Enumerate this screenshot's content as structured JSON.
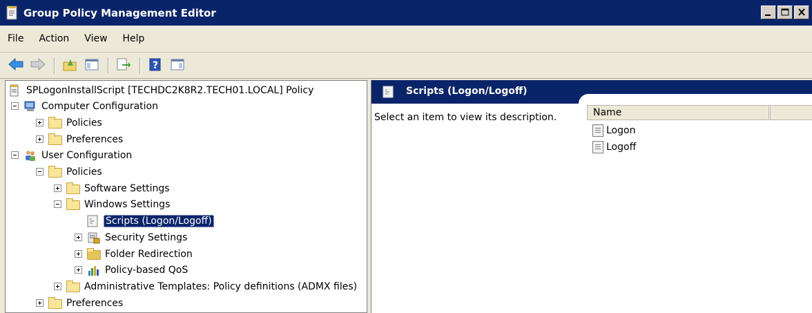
{
  "window": {
    "title": "Group Policy Management Editor",
    "title_bar_color": "#0a246a"
  },
  "menu": [
    "File",
    "Action",
    "View",
    "Help"
  ],
  "toolbar": {
    "buttons": [
      "back-arrow-icon",
      "forward-arrow-icon",
      "up-folder-icon",
      "show-hide-tree-icon",
      "export-list-icon",
      "help-icon",
      "properties-pane-icon"
    ]
  },
  "tree": {
    "root": "SPLogonInstallScript [TECHDC2K8R2.TECH01.LOCAL] Policy",
    "computer_configuration": "Computer Configuration",
    "cc_policies": "Policies",
    "cc_preferences": "Preferences",
    "user_configuration": "User Configuration",
    "uc_policies": "Policies",
    "software_settings": "Software Settings",
    "windows_settings": "Windows Settings",
    "scripts": "Scripts (Logon/Logoff)",
    "security_settings": "Security Settings",
    "folder_redirection": "Folder Redirection",
    "policy_qos": "Policy-based QoS",
    "admin_templates": "Administrative Templates: Policy definitions (ADMX files)",
    "uc_preferences": "Preferences"
  },
  "right_pane": {
    "title": "Scripts (Logon/Logoff)",
    "description": "Select an item to view its description.",
    "column_name": "Name",
    "items": [
      "Logon",
      "Logoff"
    ]
  }
}
